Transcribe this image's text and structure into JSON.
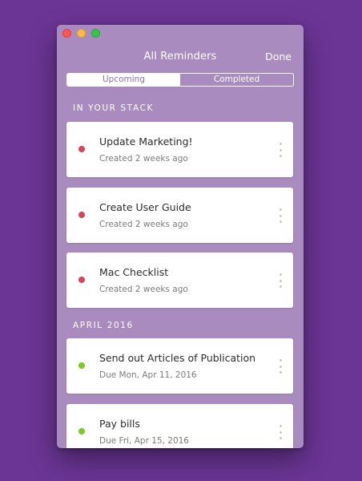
{
  "window": {
    "title": "All Reminders",
    "done_label": "Done",
    "background": "#a98bbf"
  },
  "segments": [
    {
      "label": "Upcoming",
      "selected": true
    },
    {
      "label": "Completed",
      "selected": false
    }
  ],
  "sections": [
    {
      "header": "IN YOUR STACK",
      "items": [
        {
          "title": "Update Marketing!",
          "subtitle": "Created 2 weeks ago",
          "status_color": "#d9435c"
        },
        {
          "title": "Create User Guide",
          "subtitle": "Created 2 weeks ago",
          "status_color": "#d9435c"
        },
        {
          "title": "Mac Checklist",
          "subtitle": "Created 2 weeks ago",
          "status_color": "#d9435c"
        }
      ]
    },
    {
      "header": "APRIL 2016",
      "items": [
        {
          "title": "Send out Articles of Publication",
          "subtitle": "Due Mon, Apr 11, 2016",
          "status_color": "#7ec91f"
        },
        {
          "title": "Pay bills",
          "subtitle": "Due Fri, Apr 15, 2016",
          "status_color": "#7ec91f"
        }
      ]
    }
  ],
  "icons": {
    "card_menu": "more-vertical-icon",
    "status": "status-dot-icon"
  },
  "colors": {
    "background": "#6b3595",
    "overdue": "#d9435c",
    "upcoming": "#7ec91f"
  }
}
